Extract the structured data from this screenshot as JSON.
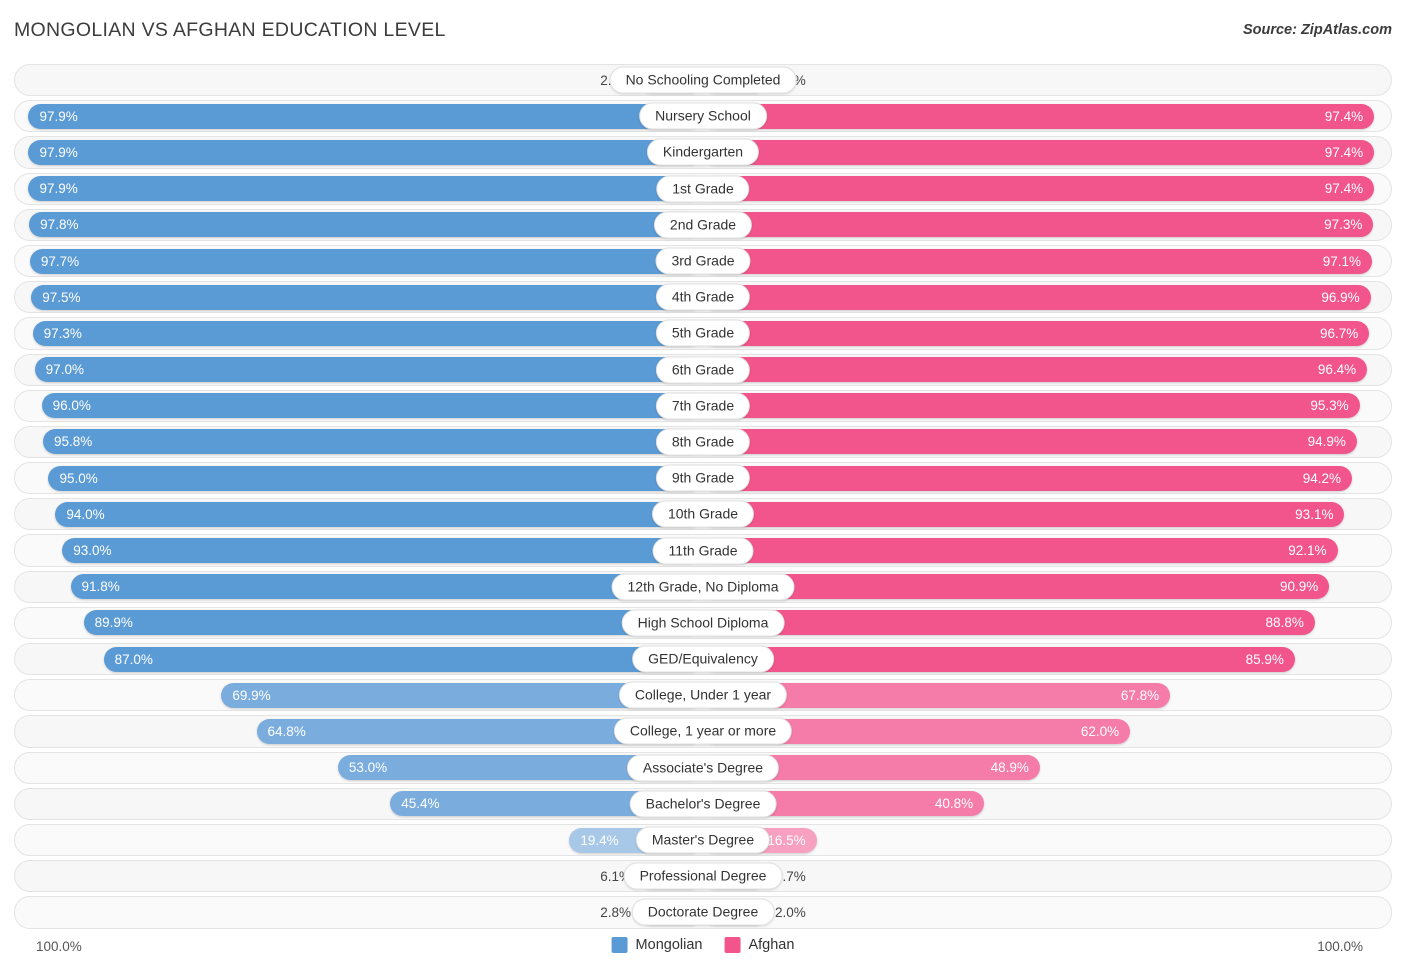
{
  "header": {
    "title": "MONGOLIAN VS AFGHAN EDUCATION LEVEL",
    "source": "Source: ZipAtlas.com"
  },
  "legend": {
    "series": [
      {
        "name": "Mongolian",
        "color": "#5b9bd5"
      },
      {
        "name": "Afghan",
        "color": "#f2558c"
      }
    ]
  },
  "axis": {
    "left_max": "100.0%",
    "right_max": "100.0%"
  },
  "chart_data": {
    "type": "bar",
    "title": "MONGOLIAN VS AFGHAN EDUCATION LEVEL",
    "subtitle": "Source: ZipAtlas.com",
    "orientation": "horizontal-diverging",
    "xlabel": "",
    "ylabel": "",
    "xlim": [
      0,
      100
    ],
    "grid": false,
    "legend_position": "bottom-center",
    "categories": [
      "No Schooling Completed",
      "Nursery School",
      "Kindergarten",
      "1st Grade",
      "2nd Grade",
      "3rd Grade",
      "4th Grade",
      "5th Grade",
      "6th Grade",
      "7th Grade",
      "8th Grade",
      "9th Grade",
      "10th Grade",
      "11th Grade",
      "12th Grade, No Diploma",
      "High School Diploma",
      "GED/Equivalency",
      "College, Under 1 year",
      "College, 1 year or more",
      "Associate's Degree",
      "Bachelor's Degree",
      "Master's Degree",
      "Professional Degree",
      "Doctorate Degree"
    ],
    "series": [
      {
        "name": "Mongolian",
        "color": "#5b9bd5",
        "values": [
          2.1,
          97.9,
          97.9,
          97.9,
          97.8,
          97.7,
          97.5,
          97.3,
          97.0,
          96.0,
          95.8,
          95.0,
          94.0,
          93.0,
          91.8,
          89.9,
          87.0,
          69.9,
          64.8,
          53.0,
          45.4,
          19.4,
          6.1,
          2.8
        ],
        "labels": [
          "2.1%",
          "97.9%",
          "97.9%",
          "97.9%",
          "97.8%",
          "97.7%",
          "97.5%",
          "97.3%",
          "97.0%",
          "96.0%",
          "95.8%",
          "95.0%",
          "94.0%",
          "93.0%",
          "91.8%",
          "89.9%",
          "87.0%",
          "69.9%",
          "64.8%",
          "53.0%",
          "45.4%",
          "19.4%",
          "6.1%",
          "2.8%"
        ]
      },
      {
        "name": "Afghan",
        "color": "#f2558c",
        "values": [
          2.6,
          97.4,
          97.4,
          97.4,
          97.3,
          97.1,
          96.9,
          96.7,
          96.4,
          95.3,
          94.9,
          94.2,
          93.1,
          92.1,
          90.9,
          88.8,
          85.9,
          67.8,
          62.0,
          48.9,
          40.8,
          16.5,
          4.7,
          2.0
        ],
        "labels": [
          "2.6%",
          "97.4%",
          "97.4%",
          "97.4%",
          "97.3%",
          "97.1%",
          "96.9%",
          "96.7%",
          "96.4%",
          "95.3%",
          "94.9%",
          "94.2%",
          "93.1%",
          "92.1%",
          "90.9%",
          "88.8%",
          "85.9%",
          "67.8%",
          "62.0%",
          "48.9%",
          "40.8%",
          "16.5%",
          "4.7%",
          "2.0%"
        ]
      }
    ]
  },
  "rows": [
    {
      "label": "No Schooling Completed",
      "left": 2.1,
      "left_label": "2.1%",
      "right": 2.6,
      "right_label": "2.6%"
    },
    {
      "label": "Nursery School",
      "left": 97.9,
      "left_label": "97.9%",
      "right": 97.4,
      "right_label": "97.4%"
    },
    {
      "label": "Kindergarten",
      "left": 97.9,
      "left_label": "97.9%",
      "right": 97.4,
      "right_label": "97.4%"
    },
    {
      "label": "1st Grade",
      "left": 97.9,
      "left_label": "97.9%",
      "right": 97.4,
      "right_label": "97.4%"
    },
    {
      "label": "2nd Grade",
      "left": 97.8,
      "left_label": "97.8%",
      "right": 97.3,
      "right_label": "97.3%"
    },
    {
      "label": "3rd Grade",
      "left": 97.7,
      "left_label": "97.7%",
      "right": 97.1,
      "right_label": "97.1%"
    },
    {
      "label": "4th Grade",
      "left": 97.5,
      "left_label": "97.5%",
      "right": 96.9,
      "right_label": "96.9%"
    },
    {
      "label": "5th Grade",
      "left": 97.3,
      "left_label": "97.3%",
      "right": 96.7,
      "right_label": "96.7%"
    },
    {
      "label": "6th Grade",
      "left": 97.0,
      "left_label": "97.0%",
      "right": 96.4,
      "right_label": "96.4%"
    },
    {
      "label": "7th Grade",
      "left": 96.0,
      "left_label": "96.0%",
      "right": 95.3,
      "right_label": "95.3%"
    },
    {
      "label": "8th Grade",
      "left": 95.8,
      "left_label": "95.8%",
      "right": 94.9,
      "right_label": "94.9%"
    },
    {
      "label": "9th Grade",
      "left": 95.0,
      "left_label": "95.0%",
      "right": 94.2,
      "right_label": "94.2%"
    },
    {
      "label": "10th Grade",
      "left": 94.0,
      "left_label": "94.0%",
      "right": 93.1,
      "right_label": "93.1%"
    },
    {
      "label": "11th Grade",
      "left": 93.0,
      "left_label": "93.0%",
      "right": 92.1,
      "right_label": "92.1%"
    },
    {
      "label": "12th Grade, No Diploma",
      "left": 91.8,
      "left_label": "91.8%",
      "right": 90.9,
      "right_label": "90.9%"
    },
    {
      "label": "High School Diploma",
      "left": 89.9,
      "left_label": "89.9%",
      "right": 88.8,
      "right_label": "88.8%"
    },
    {
      "label": "GED/Equivalency",
      "left": 87.0,
      "left_label": "87.0%",
      "right": 85.9,
      "right_label": "85.9%"
    },
    {
      "label": "College, Under 1 year",
      "left": 69.9,
      "left_label": "69.9%",
      "right": 67.8,
      "right_label": "67.8%"
    },
    {
      "label": "College, 1 year or more",
      "left": 64.8,
      "left_label": "64.8%",
      "right": 62.0,
      "right_label": "62.0%"
    },
    {
      "label": "Associate's Degree",
      "left": 53.0,
      "left_label": "53.0%",
      "right": 48.9,
      "right_label": "48.9%"
    },
    {
      "label": "Bachelor's Degree",
      "left": 45.4,
      "left_label": "45.4%",
      "right": 40.8,
      "right_label": "40.8%"
    },
    {
      "label": "Master's Degree",
      "left": 19.4,
      "left_label": "19.4%",
      "right": 16.5,
      "right_label": "16.5%"
    },
    {
      "label": "Professional Degree",
      "left": 6.1,
      "left_label": "6.1%",
      "right": 4.7,
      "right_label": "4.7%"
    },
    {
      "label": "Doctorate Degree",
      "left": 2.8,
      "left_label": "2.8%",
      "right": 2.0,
      "right_label": "2.0%"
    }
  ]
}
